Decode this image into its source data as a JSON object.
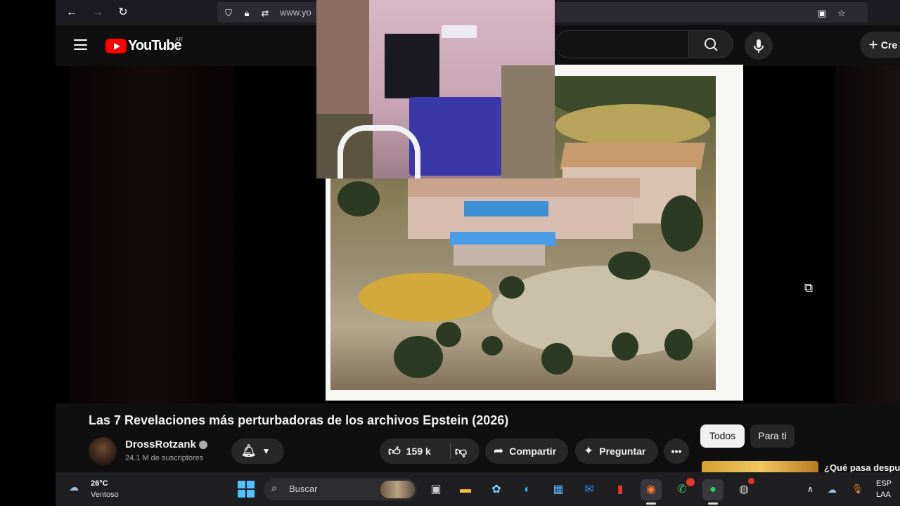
{
  "browser": {
    "url_text": "www.yo",
    "icons": [
      "back-icon",
      "forward-icon",
      "reload-icon",
      "shield-icon",
      "lock-icon",
      "permissions-icon",
      "picture-in-picture-icon",
      "bookmark-star-icon"
    ]
  },
  "youtube_header": {
    "logo_text": "YouTube",
    "country_code": "AR",
    "create_label": "Cre"
  },
  "video": {
    "title": "Las 7 Revelaciones más perturbadoras de los archivos Epstein (2026)"
  },
  "channel": {
    "name": "DrossRotzank",
    "subscribers": "24.1 M de suscriptores"
  },
  "actions": {
    "like_count": "159 k",
    "share_label": "Compartir",
    "ask_label": "Preguntar"
  },
  "chips": {
    "all": "Todos",
    "for_you": "Para ti"
  },
  "next_video": {
    "title": "¿Qué pasa despu"
  },
  "taskbar": {
    "weather_temp": "26°C",
    "weather_desc": "Ventoso",
    "search_label": "Buscar",
    "lang_1": "ESP",
    "lang_2": "LAA"
  },
  "colors": {
    "youtube_red": "#ff0000",
    "page_bg": "#0f0f0f",
    "pill_bg": "#272727",
    "notification_badge": "#e0362c"
  }
}
